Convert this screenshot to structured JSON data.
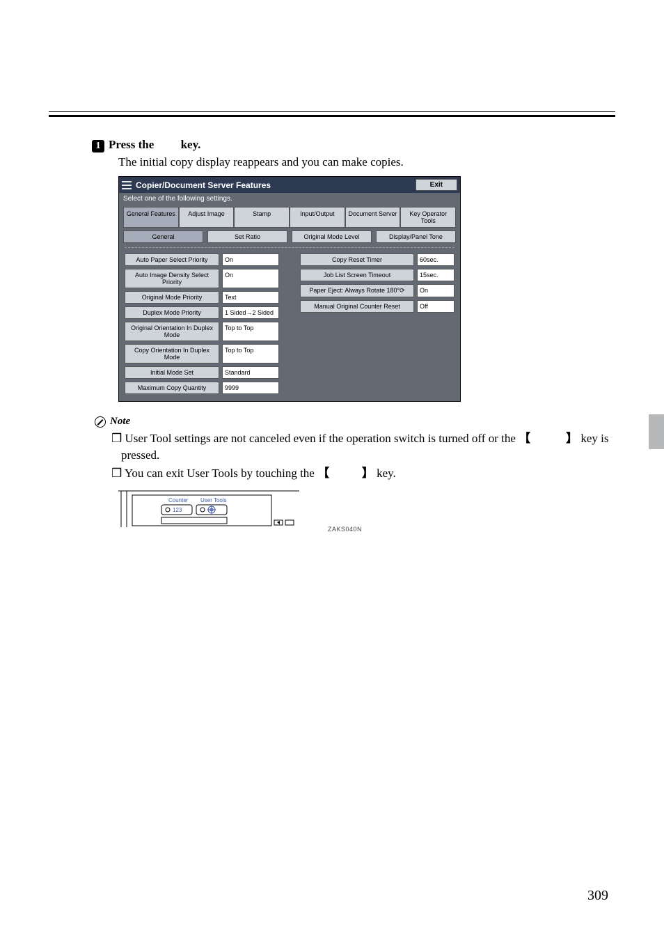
{
  "step": {
    "badge": "1",
    "text_prefix": "Press the ",
    "text_suffix": " key."
  },
  "body_line": "The initial copy display reappears and you can make copies.",
  "screenshot": {
    "title": "Copier/Document Server Features",
    "exit": "Exit",
    "instruction": "Select one of the following settings.",
    "tabs": [
      "General Features",
      "Adjust Image",
      "Stamp",
      "Input/Output",
      "Document Server",
      "Key Operator Tools"
    ],
    "active_tab_index": 0,
    "subtabs": [
      "General",
      "Set Ratio",
      "Original Mode Level",
      "Display/Panel Tone"
    ],
    "active_subtab_index": 0,
    "left_rows": [
      {
        "label": "Auto Paper Select Priority",
        "value": "On"
      },
      {
        "label": "Auto Image Density Select Priority",
        "value": "On"
      },
      {
        "label": "Original Mode Priority",
        "value": "Text"
      },
      {
        "label": "Duplex Mode Priority",
        "value": "1 Sided→2 Sided"
      },
      {
        "label": "Original Orientation In Duplex Mode",
        "value": "Top to Top"
      },
      {
        "label": "Copy Orientation In Duplex Mode",
        "value": "Top to Top"
      },
      {
        "label": "Initial Mode Set",
        "value": "Standard"
      },
      {
        "label": "Maximum Copy Quantity",
        "value": "9999"
      }
    ],
    "right_rows": [
      {
        "label": "Copy Reset Timer",
        "value": "60sec."
      },
      {
        "label": "Job List Screen Timeout",
        "value": "15sec."
      },
      {
        "label": "Paper Eject: Always Rotate 180°⟳",
        "value": "On"
      },
      {
        "label": "Manual Original Counter Reset",
        "value": "Off"
      }
    ]
  },
  "note": {
    "heading": "Note",
    "items_text": {
      "item1_a": "User Tool settings are not canceled even if the operation switch is turned off or the ",
      "item1_b": " key is pressed.",
      "item2_a": "You can exit User Tools by touching the ",
      "item2_b": " key."
    }
  },
  "brackets": {
    "open": "【",
    "close": "】"
  },
  "control_panel": {
    "counter_label": "Counter",
    "usertools_label": "User Tools",
    "fig_code": "ZAKS040N"
  },
  "page_number": "309"
}
